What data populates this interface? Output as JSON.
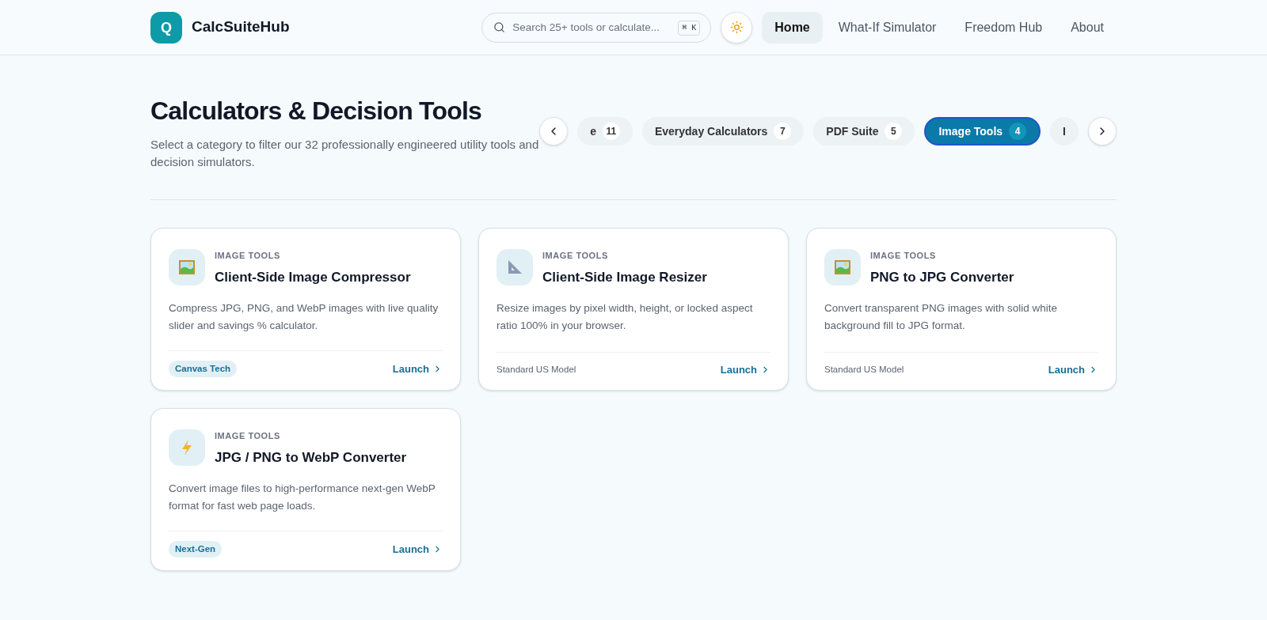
{
  "brand": {
    "logo_letter": "Q",
    "name": "CalcSuiteHub"
  },
  "search": {
    "placeholder": "Search 25+ tools or calculate...",
    "shortcut": "⌘ K"
  },
  "nav": [
    {
      "label": "Home",
      "selected": true
    },
    {
      "label": "What-If Simulator",
      "selected": false
    },
    {
      "label": "Freedom Hub",
      "selected": false
    },
    {
      "label": "About",
      "selected": false
    }
  ],
  "heading": {
    "title": "Calculators & Decision Tools",
    "subtitle": "Select a category to filter our 32 professionally engineered utility tools and decision simulators."
  },
  "categories": [
    {
      "label": "e",
      "count": "11",
      "selected": false
    },
    {
      "label": "Everyday Calculators",
      "count": "7",
      "selected": false
    },
    {
      "label": "PDF Suite",
      "count": "5",
      "selected": false
    },
    {
      "label": "Image Tools",
      "count": "4",
      "selected": true
    },
    {
      "label": "I",
      "selected": false
    }
  ],
  "cards": [
    {
      "kind": "frame",
      "category": "IMAGE TOOLS",
      "title": "Client-Side Image Compressor",
      "description": "Compress JPG, PNG, and WebP images with live quality slider and savings % calculator.",
      "footer": {
        "kind": "tag",
        "text": "Canvas Tech"
      },
      "action": "Launch"
    },
    {
      "kind": "ruler",
      "category": "IMAGE TOOLS",
      "title": "Client-Side Image Resizer",
      "description": "Resize images by pixel width, height, or locked aspect ratio 100% in your browser.",
      "footer": {
        "kind": "note",
        "text": "Standard US Model"
      },
      "action": "Launch"
    },
    {
      "kind": "frame",
      "category": "IMAGE TOOLS",
      "title": "PNG to JPG Converter",
      "description": "Convert transparent PNG images with solid white background fill to JPG format.",
      "footer": {
        "kind": "note",
        "text": "Standard US Model"
      },
      "action": "Launch"
    },
    {
      "kind": "bolt",
      "category": "IMAGE TOOLS",
      "title": "JPG / PNG to WebP Converter",
      "description": "Convert image files to high-performance next-gen WebP format for fast web page loads.",
      "footer": {
        "kind": "tag",
        "text": "Next-Gen"
      },
      "action": "Launch"
    }
  ]
}
